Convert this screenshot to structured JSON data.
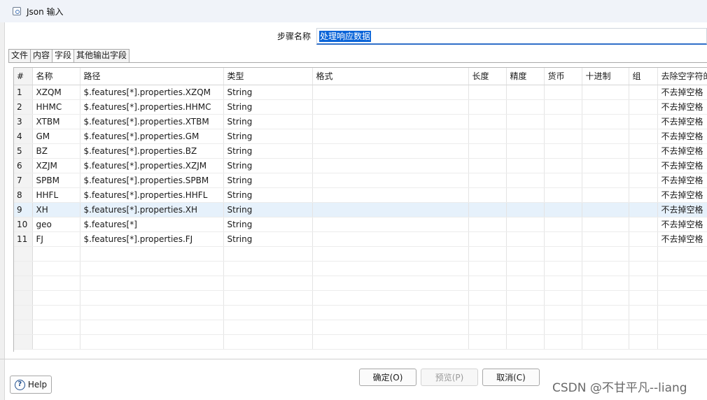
{
  "window": {
    "title": "Json 输入"
  },
  "step": {
    "label": "步骤名称",
    "value": "处理响应数据"
  },
  "tabs": [
    "文件",
    "内容",
    "字段",
    "其他输出字段"
  ],
  "grid": {
    "columns": [
      "#",
      "名称",
      "路径",
      "类型",
      "格式",
      "长度",
      "精度",
      "货币",
      "十进制",
      "组",
      "去除空字符的"
    ],
    "rows": [
      [
        "1",
        "XZQM",
        "$.features[*].properties.XZQM",
        "String",
        "不去掉空格"
      ],
      [
        "2",
        "HHMC",
        "$.features[*].properties.HHMC",
        "String",
        "不去掉空格"
      ],
      [
        "3",
        "XTBM",
        "$.features[*].properties.XTBM",
        "String",
        "不去掉空格"
      ],
      [
        "4",
        "GM",
        "$.features[*].properties.GM",
        "String",
        "不去掉空格"
      ],
      [
        "5",
        "BZ",
        "$.features[*].properties.BZ",
        "String",
        "不去掉空格"
      ],
      [
        "6",
        "XZJM",
        "$.features[*].properties.XZJM",
        "String",
        "不去掉空格"
      ],
      [
        "7",
        "SPBM",
        "$.features[*].properties.SPBM",
        "String",
        "不去掉空格"
      ],
      [
        "8",
        "HHFL",
        "$.features[*].properties.HHFL",
        "String",
        "不去掉空格"
      ],
      [
        "9",
        "XH",
        "$.features[*].properties.XH",
        "String",
        "不去掉空格"
      ],
      [
        "10",
        "geo",
        "$.features[*]",
        "String",
        "不去掉空格"
      ],
      [
        "11",
        "FJ",
        "$.features[*].properties.FJ",
        "String",
        "不去掉空格"
      ]
    ]
  },
  "buttons": {
    "ok": "确定(O)",
    "preview": "预览(P)",
    "cancel": "取消(C)",
    "help": "Help"
  },
  "watermark": "CSDN @不甘平凡--liang"
}
